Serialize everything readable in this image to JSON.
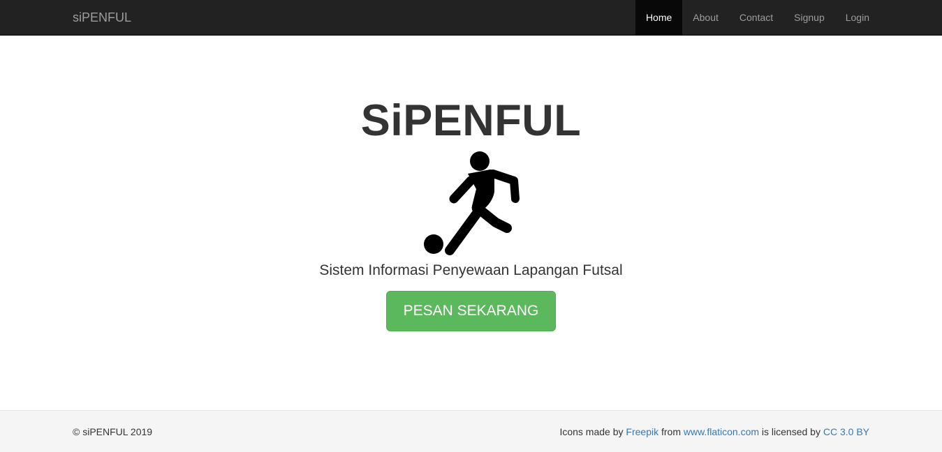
{
  "navbar": {
    "brand": "siPENFUL",
    "items": [
      {
        "label": "Home",
        "active": true
      },
      {
        "label": "About"
      },
      {
        "label": "Contact"
      },
      {
        "label": "Signup"
      },
      {
        "label": "Login"
      }
    ]
  },
  "hero": {
    "title": "SiPENFUL",
    "icon": "football-player-icon",
    "subtitle": "Sistem Informasi Penyewaan Lapangan Futsal",
    "cta_label": "PESAN SEKARANG"
  },
  "footer": {
    "copyright": "© siPENFUL 2019",
    "credit_prefix": "Icons made by",
    "credit_author": "Freepik",
    "credit_from": "from",
    "credit_site": "www.flaticon.com",
    "credit_licensed": "is licensed by",
    "credit_license": "CC 3.0 BY"
  },
  "colors": {
    "navbar_bg": "#222222",
    "nav_active_bg": "#080808",
    "cta_green": "#5cb85c",
    "link_blue": "#337ab7",
    "footer_bg": "#f5f5f5"
  }
}
